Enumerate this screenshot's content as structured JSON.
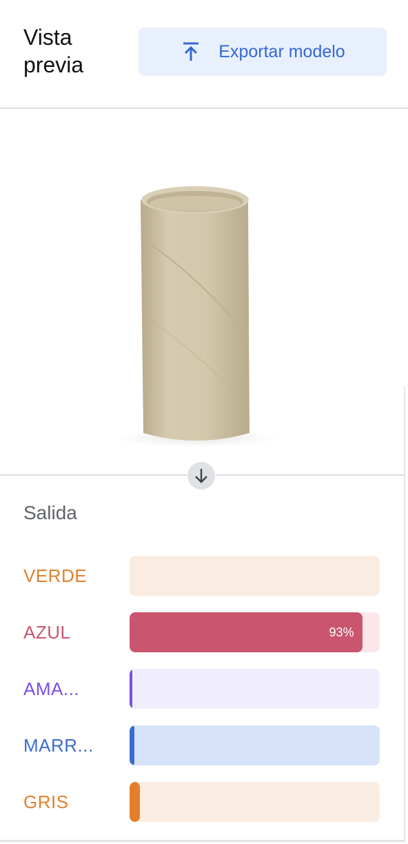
{
  "header": {
    "title": "Vista\nprevia",
    "export_label": "Exportar modelo",
    "export_icon": "upload-icon"
  },
  "preview": {
    "arrow_icon": "arrow-down-icon"
  },
  "output": {
    "title": "Salida",
    "classes": [
      {
        "label": "VERDE",
        "fraction": 0.0,
        "percent_text": "",
        "text_color": "#e37f2c",
        "fill_color": "#e37f2c",
        "track_color": "#fbece1"
      },
      {
        "label": "AZUL",
        "fraction": 0.93,
        "percent_text": "93%",
        "text_color": "#c9556e",
        "fill_color": "#c9556e",
        "track_color": "#fbe7ea"
      },
      {
        "label": "AMA...",
        "fraction": 0.005,
        "percent_text": "",
        "text_color": "#7a4ee8",
        "fill_color": "#7a4ee8",
        "track_color": "#f0eefd"
      },
      {
        "label": "MARR...",
        "fraction": 0.02,
        "percent_text": "",
        "text_color": "#3b6cd1",
        "fill_color": "#3b6cd1",
        "track_color": "#d7e3f9"
      },
      {
        "label": "GRIS",
        "fraction": 0.04,
        "percent_text": "",
        "text_color": "#e37f2c",
        "fill_color": "#e37f2c",
        "track_color": "#fbece1"
      }
    ]
  }
}
